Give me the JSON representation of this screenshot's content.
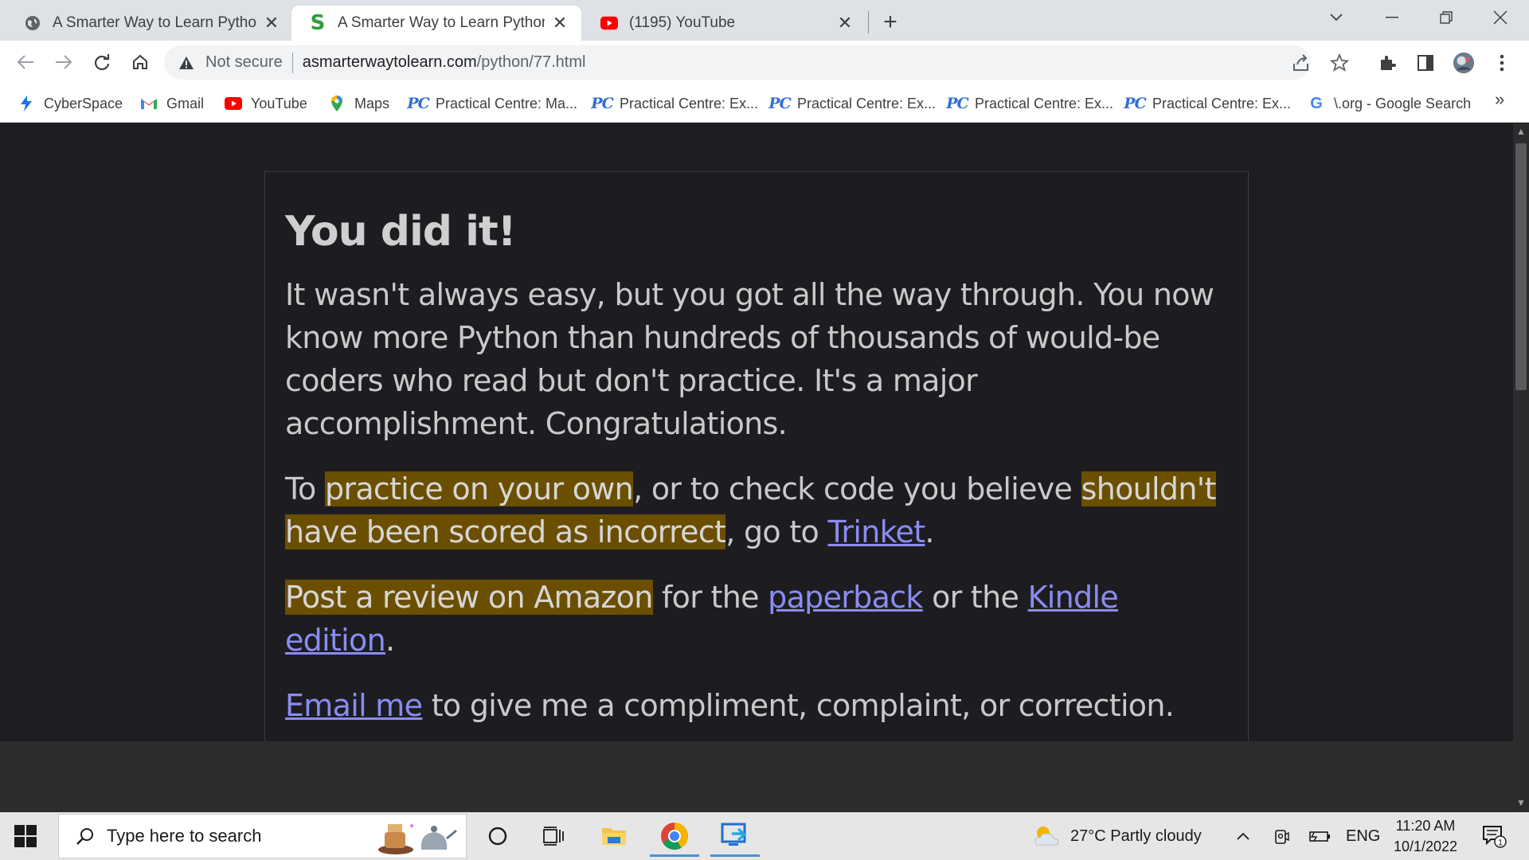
{
  "browser": {
    "tabs": [
      {
        "title": "A Smarter Way to Learn Python: Le",
        "favicon": "globe-icon",
        "active": false
      },
      {
        "title": "A Smarter Way to Learn Python - ",
        "favicon": "green-s-icon",
        "active": true
      },
      {
        "title": "(1195) YouTube",
        "favicon": "youtube-icon",
        "active": false
      }
    ],
    "new_tab_label": "+",
    "security_label": "Not secure",
    "url_host": "asmarterwaytolearn.com",
    "url_path": "/python/77.html",
    "bookmarks": [
      {
        "label": "CyberSpace",
        "icon": "cyberspace-icon"
      },
      {
        "label": "Gmail",
        "icon": "gmail-icon"
      },
      {
        "label": "YouTube",
        "icon": "youtube-icon"
      },
      {
        "label": "Maps",
        "icon": "maps-icon"
      },
      {
        "label": "Practical Centre: Ma...",
        "icon": "pc-icon"
      },
      {
        "label": "Practical Centre: Ex...",
        "icon": "pc-icon"
      },
      {
        "label": "Practical Centre: Ex...",
        "icon": "pc-icon"
      },
      {
        "label": "Practical Centre: Ex...",
        "icon": "pc-icon"
      },
      {
        "label": "Practical Centre: Ex...",
        "icon": "pc-icon"
      },
      {
        "label": "\\.org - Google Search",
        "icon": "google-icon"
      }
    ],
    "bookmarks_overflow": "»"
  },
  "page": {
    "heading": "You did it!",
    "para1": "It wasn't always easy, but you got all the way through. You now know more Python than hundreds of thousands of would-be coders who read but don't practice. It's a major accomplishment. Congratulations.",
    "para2": {
      "before": "To ",
      "highlight1": "practice on your own",
      "mid": ", or to check code you believe ",
      "highlight2": "shouldn't have been scored as incorrect",
      "after_hl": ", go to ",
      "link": "Trinket",
      "end": "."
    },
    "para3": {
      "highlight": "Post a review on Amazon",
      "mid1": " for the ",
      "link1": "paperback",
      "mid2": " or the ",
      "link2": "Kindle edition",
      "end": "."
    },
    "para4": {
      "link": "Email me",
      "rest": " to give me a compliment, complaint, or correction."
    }
  },
  "taskbar": {
    "search_placeholder": "Type here to search",
    "weather": "27°C  Partly cloudy",
    "language": "ENG",
    "time": "11:20 AM",
    "date": "10/1/2022",
    "notification_count": "1"
  },
  "colors": {
    "page_bg": "#1e1e22",
    "highlight": "#6b4f00",
    "link": "#8a8cf2",
    "text": "#c9c9c9"
  }
}
